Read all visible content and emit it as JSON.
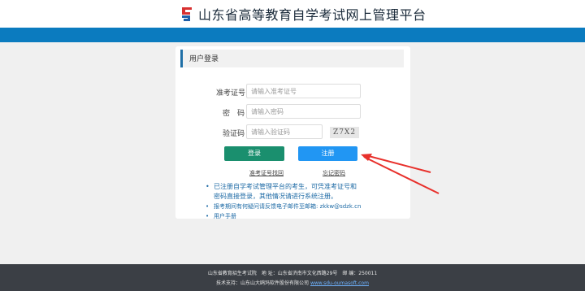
{
  "header": {
    "title": "山东省高等教育自学考试网上管理平台",
    "brand_colors": {
      "blue_bar": "#0b7bbf",
      "logo_red": "#d83030",
      "logo_blue": "#1f5fa8"
    }
  },
  "login": {
    "panel_title": "用户登录",
    "fields": [
      {
        "label": "准考证号",
        "placeholder": "请输入准考证号",
        "value": ""
      },
      {
        "label": "密　码",
        "placeholder": "请输入密码",
        "value": ""
      },
      {
        "label": "验证码",
        "placeholder": "请输入验证码",
        "value": ""
      }
    ],
    "captcha_text": "Z7X2",
    "login_button": "登录",
    "register_button": "注册",
    "links": {
      "retrieve_id": "准考证号找回",
      "forgot_password": "忘记密码"
    },
    "button_colors": {
      "login": "#1a8f6e",
      "register": "#2196f3"
    }
  },
  "notice": {
    "line1": "已注册自学考试管理平台的考生，可凭准考证号和",
    "line1b": "密码直接登录，其他情况请进行系统注册。",
    "line2": "报考期间有何疑问请反馈电子邮件至邮箱: zkkw@sdzk.cn",
    "line3": "用户手册"
  },
  "footer": {
    "line1": "山东省教育招生考试院　地 址：山东省济南市文化西路29号　邮 编：250011",
    "line2": "技术支持：山东山大鸥玛软件股份有限公司",
    "line2_link": "www.sdu-oumasoft.com"
  },
  "annotation": {
    "arrow_color": "#e8302b"
  }
}
